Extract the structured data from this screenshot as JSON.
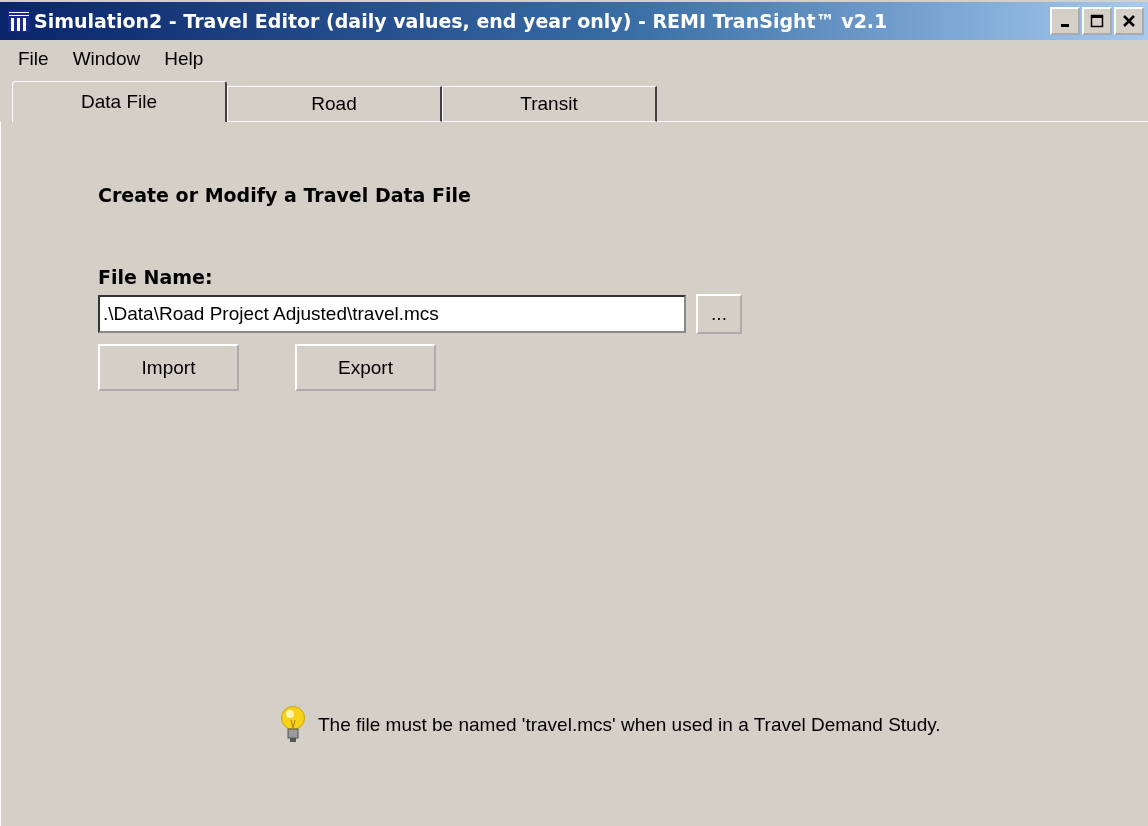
{
  "window": {
    "title": "Simulation2 - Travel Editor (daily values, end year only) - REMI TranSight™ v2.1"
  },
  "menu": [
    "File",
    "Window",
    "Help"
  ],
  "tabs": [
    {
      "label": "Data File",
      "selected": true
    },
    {
      "label": "Road",
      "selected": false
    },
    {
      "label": "Transit",
      "selected": false
    }
  ],
  "panel": {
    "heading": "Create or Modify a Travel Data File",
    "file_label": "File Name:",
    "file_field": {
      "value": ".\\Data\\Road Project Adjusted\\travel.mcs"
    },
    "browse_button": "...",
    "buttons": [
      "Import",
      "Export"
    ],
    "tip": "The file must be named 'travel.mcs' when used in a Travel Demand Study."
  }
}
